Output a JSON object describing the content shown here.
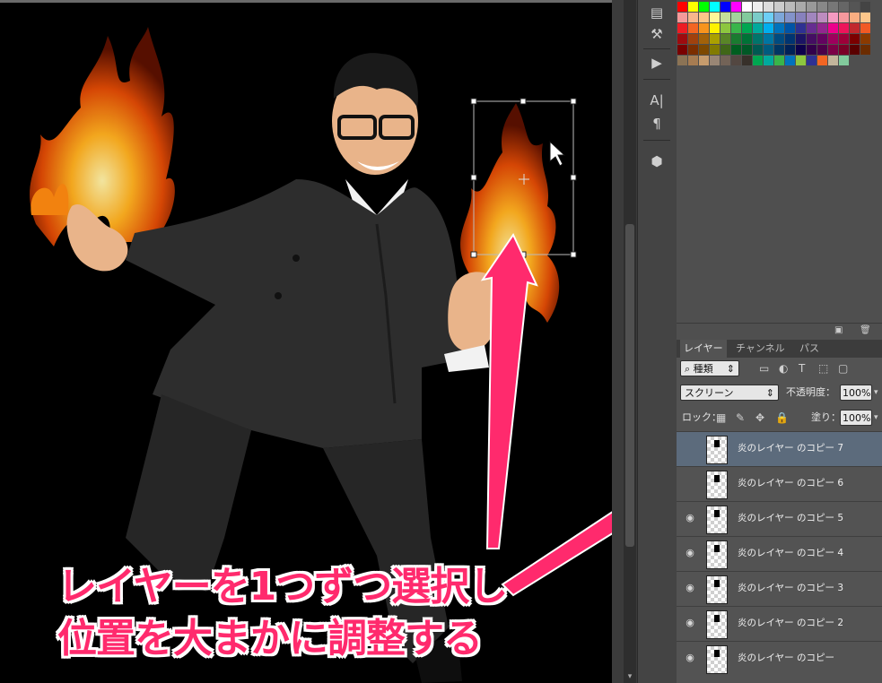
{
  "layers_panel": {
    "tabs": [
      "レイヤー",
      "チャンネル",
      "パス"
    ],
    "filter_kind": "種類",
    "blend_mode": "スクリーン",
    "opacity_label": "不透明度：",
    "opacity_value": "100%",
    "lock_label": "ロック：",
    "fill_label": "塗り：",
    "fill_value": "100%",
    "layers": [
      {
        "name": "炎のレイヤー のコピー 7",
        "selected": true,
        "visible": false
      },
      {
        "name": "炎のレイヤー のコピー 6",
        "selected": false,
        "visible": false
      },
      {
        "name": "炎のレイヤー のコピー 5",
        "selected": false,
        "visible": true
      },
      {
        "name": "炎のレイヤー のコピー 4",
        "selected": false,
        "visible": true
      },
      {
        "name": "炎のレイヤー のコピー 3",
        "selected": false,
        "visible": true
      },
      {
        "name": "炎のレイヤー のコピー 2",
        "selected": false,
        "visible": true
      },
      {
        "name": "炎のレイヤー のコピー",
        "selected": false,
        "visible": true
      }
    ]
  },
  "annotation": {
    "line1": "レイヤーを1つずつ選択し",
    "line2": "位置を大まかに調整する",
    "color": "#ff2a6d"
  },
  "icons": {
    "dock": [
      "brush-presets-icon",
      "tool-presets-icon",
      "play-actions-icon",
      "character-icon",
      "paragraph-icon",
      "3d-cube-icon"
    ],
    "layer_filter": [
      "search-icon",
      "image-filter-icon",
      "adjustment-filter-icon",
      "type-filter-icon",
      "shape-filter-icon",
      "smart-object-filter-icon"
    ],
    "lock": [
      "lock-pixels-icon",
      "lock-paint-icon",
      "lock-position-icon",
      "lock-all-icon"
    ]
  },
  "swatch_colors": [
    [
      "#ff0000",
      "#ffff00",
      "#00ff00",
      "#00ffff",
      "#0000ff",
      "#ff00ff",
      "#ffffff",
      "#eeeeee",
      "#dddddd",
      "#cccccc",
      "#bbbbbb",
      "#aaaaaa",
      "#999999",
      "#888888",
      "#777777",
      "#666666",
      "#555555",
      "#444444"
    ],
    [
      "#f49a9a",
      "#f9b68c",
      "#fdc689",
      "#fff799",
      "#c4df9b",
      "#a3d39c",
      "#82ca9c",
      "#7accc8",
      "#6dcff6",
      "#7da7d9",
      "#8393ca",
      "#8781bd",
      "#a186be",
      "#bd8cbf",
      "#f49ac1",
      "#f6989d",
      "#f9ad81",
      "#fdc68a"
    ],
    [
      "#ed1c24",
      "#f26522",
      "#f7941d",
      "#fff200",
      "#8dc63f",
      "#39b54a",
      "#00a651",
      "#00a99d",
      "#00aeef",
      "#0072bc",
      "#0054a6",
      "#2e3192",
      "#662d91",
      "#92278f",
      "#ec008c",
      "#ed145b",
      "#c1272d",
      "#f15a24"
    ],
    [
      "#9e0b0f",
      "#a0410d",
      "#a36209",
      "#aba000",
      "#598527",
      "#1a7b30",
      "#007236",
      "#00746b",
      "#0076a3",
      "#004b80",
      "#003471",
      "#1b1464",
      "#440e62",
      "#630460",
      "#9e005d",
      "#9e0039",
      "#7b0000",
      "#8b3a00"
    ],
    [
      "#790000",
      "#7b2e00",
      "#7d4900",
      "#827b00",
      "#406618",
      "#005e20",
      "#005826",
      "#005952",
      "#005b7f",
      "#003663",
      "#002157",
      "#0d004c",
      "#32004b",
      "#4b0049",
      "#7b0046",
      "#7a0026",
      "#5a0000",
      "#6b2c00"
    ],
    [
      "#8b7355",
      "#a67c52",
      "#c69c6d",
      "#998675",
      "#736357",
      "#534741",
      "#37302a",
      "#00a651",
      "#00a99d",
      "#39b54a",
      "#0072bc",
      "#8dc63f",
      "#2e3192",
      "#f26522",
      "#c2b59b",
      "#82ca9c"
    ]
  ]
}
